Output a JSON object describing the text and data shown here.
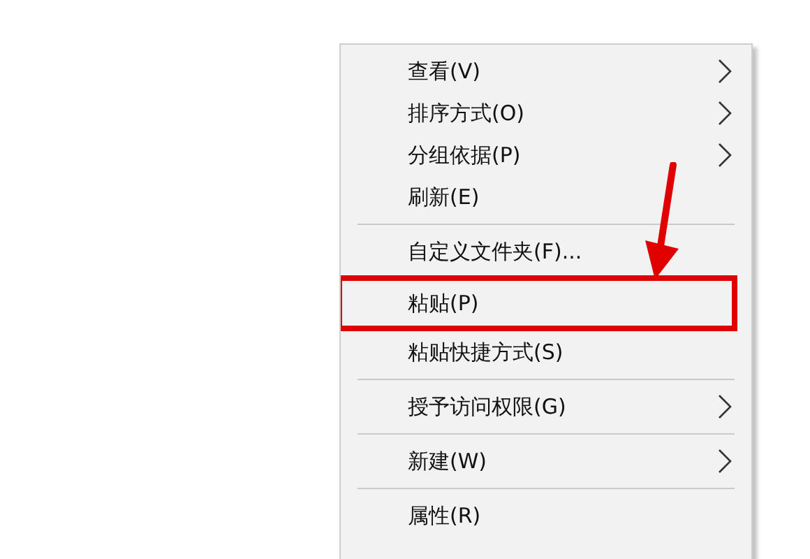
{
  "context_menu": {
    "items": [
      {
        "kind": "item",
        "label": "查看(V)",
        "submenu": true,
        "annotated": false
      },
      {
        "kind": "item",
        "label": "排序方式(O)",
        "submenu": true,
        "annotated": false
      },
      {
        "kind": "item",
        "label": "分组依据(P)",
        "submenu": true,
        "annotated": false
      },
      {
        "kind": "item",
        "label": "刷新(E)",
        "submenu": false,
        "annotated": false
      },
      {
        "kind": "separator"
      },
      {
        "kind": "item",
        "label": "自定义文件夹(F)...",
        "submenu": false,
        "annotated": false
      },
      {
        "kind": "item",
        "label": "粘贴(P)",
        "submenu": false,
        "annotated": true
      },
      {
        "kind": "item",
        "label": "粘贴快捷方式(S)",
        "submenu": false,
        "annotated": false
      },
      {
        "kind": "separator"
      },
      {
        "kind": "item",
        "label": "授予访问权限(G)",
        "submenu": true,
        "annotated": false
      },
      {
        "kind": "separator"
      },
      {
        "kind": "item",
        "label": "新建(W)",
        "submenu": true,
        "annotated": false
      },
      {
        "kind": "separator"
      },
      {
        "kind": "item",
        "label": "属性(R)",
        "submenu": false,
        "annotated": false
      }
    ]
  }
}
